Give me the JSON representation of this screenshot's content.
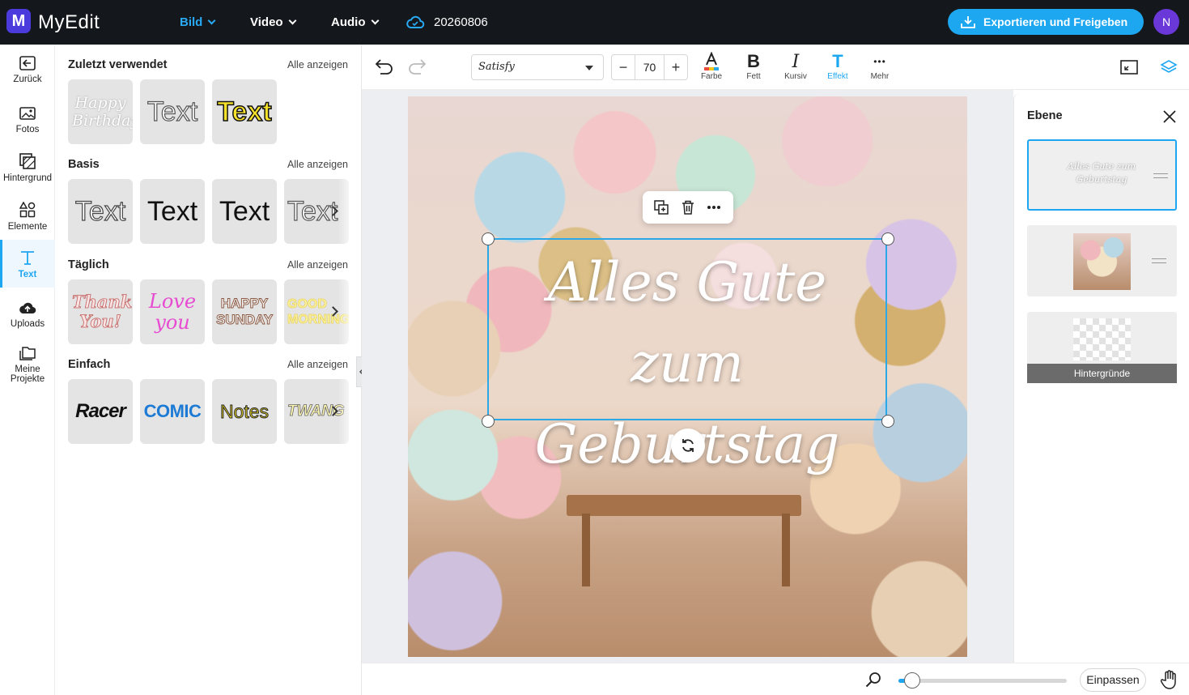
{
  "app": {
    "name": "MyEdit",
    "logo_letter": "M",
    "project_name": "20260806"
  },
  "nav": {
    "bild": "Bild",
    "video": "Video",
    "audio": "Audio"
  },
  "header": {
    "export_label": "Exportieren und Freigeben",
    "avatar_letter": "N"
  },
  "sidebar": {
    "items": [
      {
        "label": "Zurück",
        "icon": "back-arrow-icon"
      },
      {
        "label": "Fotos",
        "icon": "image-icon"
      },
      {
        "label": "Hintergrund",
        "icon": "background-icon"
      },
      {
        "label": "Elemente",
        "icon": "elements-icon"
      },
      {
        "label": "Text",
        "icon": "text-icon",
        "active": true
      },
      {
        "label": "Uploads",
        "icon": "cloud-upload-icon"
      },
      {
        "label": "Meine Projekte",
        "icon": "folder-icon"
      }
    ]
  },
  "panel": {
    "see_all": "Alle anzeigen",
    "sections": [
      {
        "title": "Zuletzt verwendet",
        "tiles": [
          "Happy Birthday",
          "Text",
          "Text"
        ]
      },
      {
        "title": "Basis",
        "tiles": [
          "Text",
          "Text",
          "Text",
          "Text"
        ]
      },
      {
        "title": "Täglich",
        "tiles": [
          "Thank You!",
          "Love you",
          "HAPPY SUNDAY",
          "GOOD MORNING"
        ]
      },
      {
        "title": "Einfach",
        "tiles": [
          "Racer",
          "COMIC",
          "Notes",
          "TWANG"
        ]
      }
    ]
  },
  "toolbar": {
    "font": "Satisfy",
    "font_size": "70",
    "minus": "−",
    "plus": "+",
    "tools": [
      {
        "label": "Farbe",
        "icon": "text-color-icon"
      },
      {
        "label": "Fett",
        "icon": "bold-icon",
        "glyph": "B"
      },
      {
        "label": "Kursiv",
        "icon": "italic-icon",
        "glyph": "I"
      },
      {
        "label": "Effekt",
        "icon": "text-effect-icon",
        "glyph": "T",
        "active": true
      },
      {
        "label": "Mehr",
        "icon": "more-icon",
        "glyph": "•••"
      }
    ]
  },
  "canvas": {
    "text_line1": "Alles Gute",
    "text_line2": "zum Geburtstag"
  },
  "layers": {
    "title": "Ebene",
    "items": [
      {
        "type": "text",
        "preview": "Alles Gute zum Geburtstag",
        "selected": true
      },
      {
        "type": "photo"
      },
      {
        "type": "background",
        "label": "Hintergründe"
      }
    ]
  },
  "bottom": {
    "fit_label": "Einpassen",
    "zoom_fraction": 0.08
  },
  "colors": {
    "accent": "#1ea7f1",
    "topbar": "#14171c",
    "avatar": "#6a37d8",
    "logo": "#4b3bdc"
  }
}
